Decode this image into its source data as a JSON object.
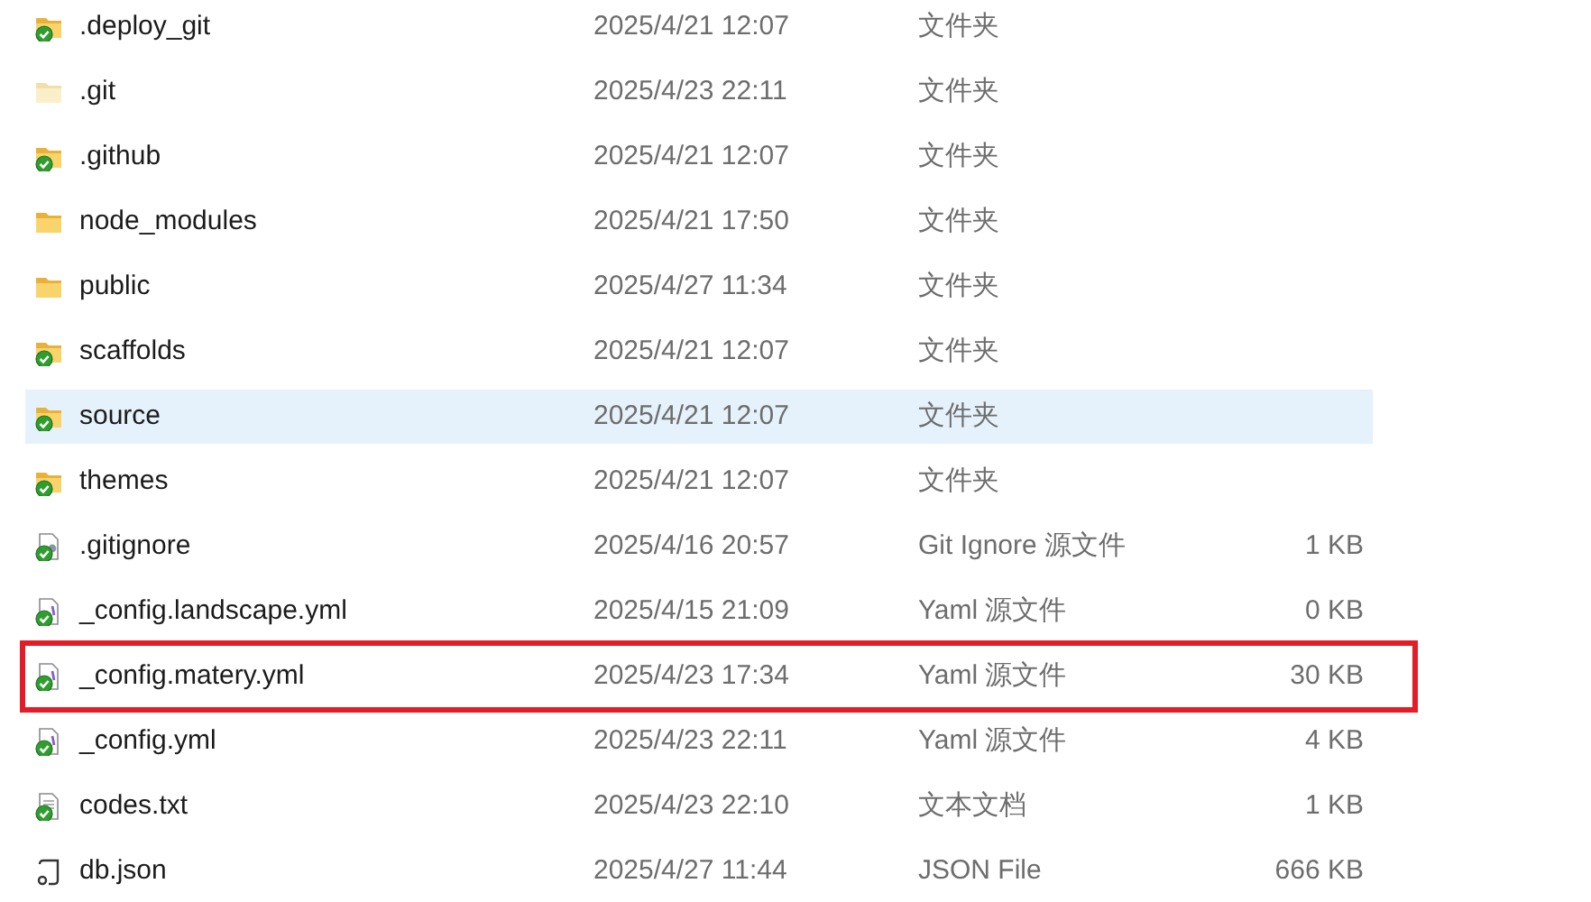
{
  "rows": [
    {
      "name": ".deploy_git",
      "modified": "2025/4/21 12:07",
      "type": "文件夹",
      "kind": "folder",
      "synced": true,
      "selected": false,
      "marked": false
    },
    {
      "name": ".git",
      "modified": "2025/4/23 22:11",
      "type": "文件夹",
      "kind": "hidden-folder",
      "synced": false,
      "selected": false,
      "marked": false
    },
    {
      "name": ".github",
      "modified": "2025/4/21 12:07",
      "type": "文件夹",
      "kind": "folder",
      "synced": true,
      "selected": false,
      "marked": false
    },
    {
      "name": "node_modules",
      "modified": "2025/4/21 17:50",
      "type": "文件夹",
      "kind": "folder",
      "synced": false,
      "selected": false,
      "marked": false
    },
    {
      "name": "public",
      "modified": "2025/4/27 11:34",
      "type": "文件夹",
      "kind": "folder",
      "synced": false,
      "selected": false,
      "marked": false
    },
    {
      "name": "scaffolds",
      "modified": "2025/4/21 12:07",
      "type": "文件夹",
      "kind": "folder",
      "synced": true,
      "selected": false,
      "marked": false
    },
    {
      "name": "source",
      "modified": "2025/4/21 12:07",
      "type": "文件夹",
      "kind": "folder",
      "synced": true,
      "selected": true,
      "marked": false
    },
    {
      "name": "themes",
      "modified": "2025/4/21 12:07",
      "type": "文件夹",
      "kind": "folder",
      "synced": true,
      "selected": false,
      "marked": false
    },
    {
      "name": ".gitignore",
      "modified": "2025/4/16 20:57",
      "type": "Git Ignore 源文件",
      "size": "1 KB",
      "kind": "settings-file",
      "synced": true,
      "selected": false,
      "marked": false
    },
    {
      "name": "_config.landscape.yml",
      "modified": "2025/4/15 21:09",
      "type": "Yaml 源文件",
      "size": "0 KB",
      "kind": "code-file",
      "synced": true,
      "selected": false,
      "marked": false
    },
    {
      "name": "_config.matery.yml",
      "modified": "2025/4/23 17:34",
      "type": "Yaml 源文件",
      "size": "30 KB",
      "kind": "code-file",
      "synced": true,
      "selected": false,
      "marked": true
    },
    {
      "name": "_config.yml",
      "modified": "2025/4/23 22:11",
      "type": "Yaml 源文件",
      "size": "4 KB",
      "kind": "code-file",
      "synced": true,
      "selected": false,
      "marked": false
    },
    {
      "name": "codes.txt",
      "modified": "2025/4/23 22:10",
      "type": "文本文档",
      "size": "1 KB",
      "kind": "text-file",
      "synced": true,
      "selected": false,
      "marked": false
    },
    {
      "name": "db.json",
      "modified": "2025/4/27 11:44",
      "type": "JSON File",
      "size": "666 KB",
      "kind": "script-file",
      "synced": false,
      "selected": false,
      "marked": false
    }
  ]
}
